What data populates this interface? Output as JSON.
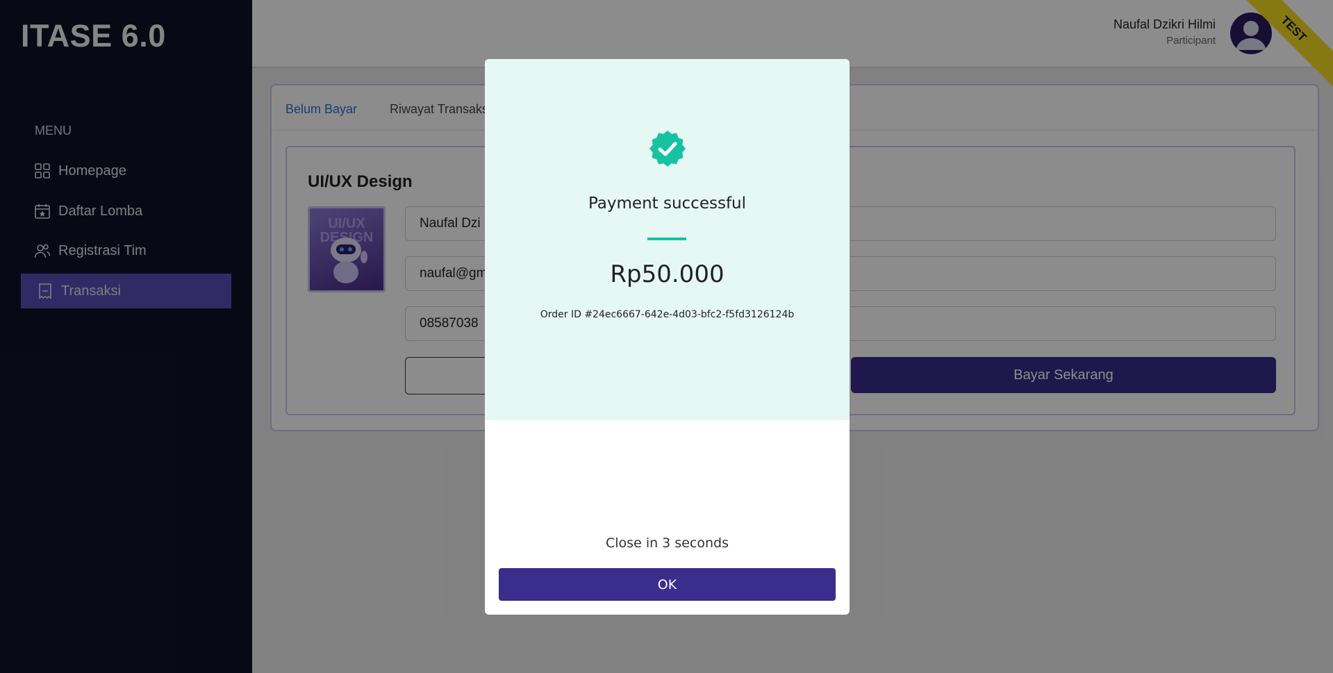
{
  "app": {
    "title": "ITASE 6.0"
  },
  "sidebar": {
    "menu_label": "MENU",
    "items": [
      {
        "label": "Homepage",
        "icon": "grid-icon"
      },
      {
        "label": "Daftar Lomba",
        "icon": "calendar-star-icon"
      },
      {
        "label": "Registrasi Tim",
        "icon": "users-icon"
      },
      {
        "label": "Transaksi",
        "icon": "receipt-icon",
        "active": true
      }
    ]
  },
  "header": {
    "user_name": "Naufal Dzikri Hilmi",
    "user_role": "Participant",
    "ribbon": "TEST"
  },
  "tabs": [
    {
      "label": "Belum Bayar",
      "active": true
    },
    {
      "label": "Riwayat Transaksi",
      "active": false
    }
  ],
  "order": {
    "competition": "UI/UX Design",
    "thumbnail_text": "UI/UX DESIGN",
    "name": "Naufal Dzi",
    "email": "naufal@gm",
    "phone": "08587038",
    "pay_button": "Bayar Sekarang"
  },
  "modal": {
    "title": "Payment successful",
    "amount": "Rp50.000",
    "order_id": "Order ID #24ec6667-642e-4d03-bfc2-f5fd3126124b",
    "close_text": "Close in 3 seconds",
    "ok_label": "OK"
  },
  "colors": {
    "sidebar": "#121229",
    "accent": "#3a2d8c",
    "success": "#17c2a3",
    "ribbon": "#f5da23",
    "link": "#2f6ed8"
  }
}
